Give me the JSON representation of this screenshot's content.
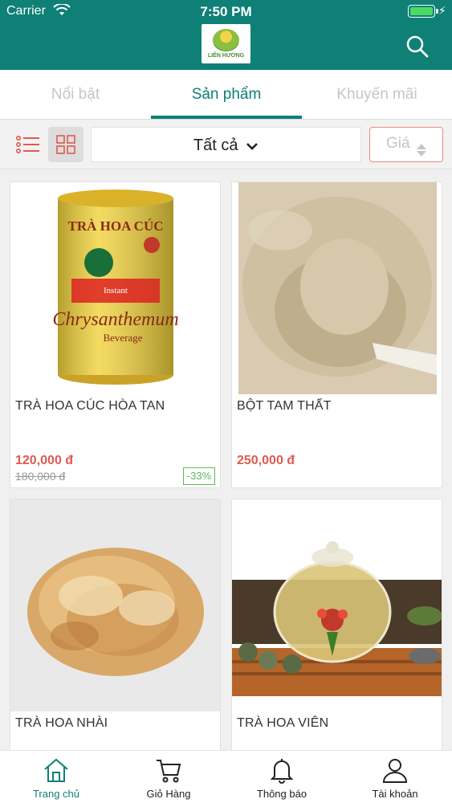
{
  "status_bar": {
    "carrier": "Carrier",
    "time": "7:50 PM"
  },
  "header": {
    "logo_text": "LIÊN HƯƠNG",
    "search_icon": "search-icon"
  },
  "tabs": [
    {
      "label": "Nổi bật"
    },
    {
      "label": "Sản phẩm"
    },
    {
      "label": "Khuyến mãi"
    }
  ],
  "active_tab": "Sản phẩm",
  "filter": {
    "category": "Tất cả",
    "price_sort": "Giá"
  },
  "products": [
    {
      "name": "TRÀ HOA CÚC HÒA TAN",
      "price": "120,000 đ",
      "old_price": "180,000 đ",
      "discount": "-33%",
      "image": "chrysanthemum-tea-can"
    },
    {
      "name": "BỘT TAM THẤT",
      "price": "250,000 đ",
      "image": "notoginseng-powder"
    },
    {
      "name": "TRÀ HOA NHÀI",
      "image": "dried-jasmine-flowers"
    },
    {
      "name": "TRÀ HOA VIÊN",
      "image": "blooming-tea-teapot"
    }
  ],
  "bottom_nav": [
    {
      "label": "Trang chủ",
      "icon": "home-icon"
    },
    {
      "label": "Giỏ Hàng",
      "icon": "cart-icon"
    },
    {
      "label": "Thông báo",
      "icon": "bell-icon"
    },
    {
      "label": "Tài khoản",
      "icon": "user-icon"
    }
  ],
  "colors": {
    "primary": "#0f8076",
    "price": "#e05a4f",
    "discount": "#5cb85c",
    "price_border": "#e88a85"
  }
}
